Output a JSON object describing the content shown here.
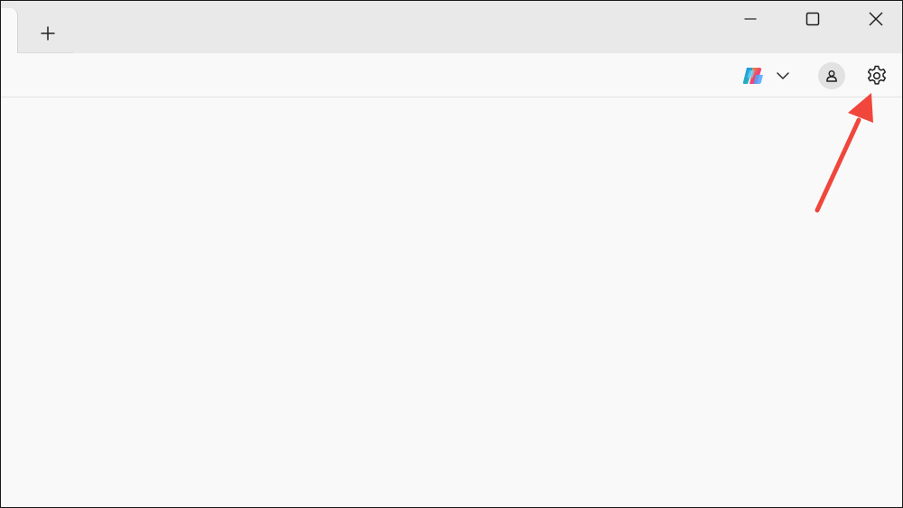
{
  "window": {
    "controls": [
      "minimize-icon",
      "maximize-icon",
      "close-icon"
    ]
  },
  "tabs": {
    "new_tab_icon": "plus-icon"
  },
  "toolbar": {
    "copilot_icon": "copilot-icon",
    "chevron_icon": "chevron-down-icon",
    "profile_icon": "profile-icon",
    "settings_icon": "gear-icon"
  },
  "annotation": {
    "arrow_color": "#f0463c",
    "points_to": "gear-icon"
  },
  "colors": {
    "titlebar": "#e9e9e9",
    "toolbar": "#f9f9f9",
    "avatar_bg": "#e2e2e2"
  }
}
